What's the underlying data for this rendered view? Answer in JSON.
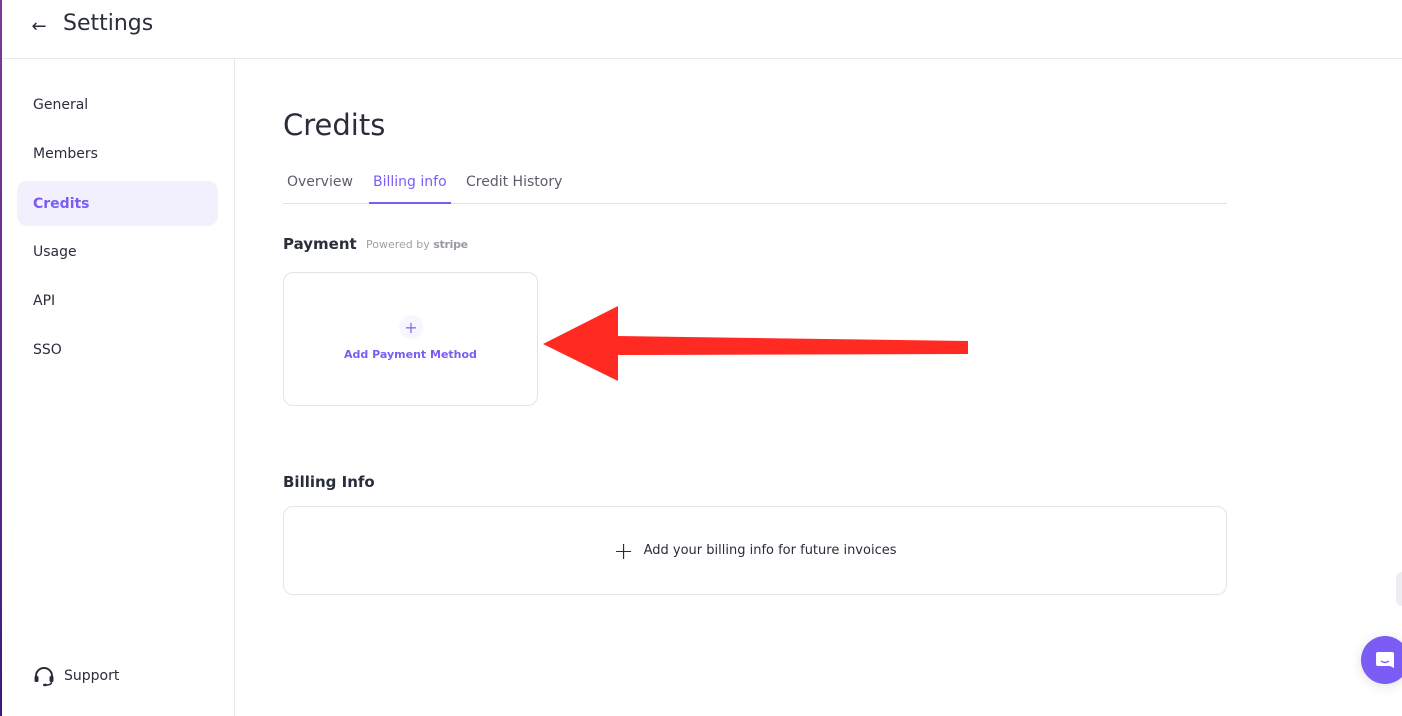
{
  "header": {
    "back_icon": "arrow-left-icon",
    "title": "Settings"
  },
  "sidebar": {
    "items": [
      {
        "label": "General",
        "active": false
      },
      {
        "label": "Members",
        "active": false
      },
      {
        "label": "Credits",
        "active": true
      },
      {
        "label": "Usage",
        "active": false
      },
      {
        "label": "API",
        "active": false
      },
      {
        "label": "SSO",
        "active": false
      }
    ],
    "support": {
      "label": "Support",
      "icon": "headset-icon"
    }
  },
  "main": {
    "title": "Credits",
    "tabs": [
      {
        "label": "Overview",
        "active": false
      },
      {
        "label": "Billing info",
        "active": true
      },
      {
        "label": "Credit History",
        "active": false
      }
    ],
    "payment": {
      "title": "Payment",
      "powered_by": "Powered by",
      "powered_brand": "stripe",
      "add_label": "Add Payment Method",
      "add_icon": "plus-icon"
    },
    "billing": {
      "title": "Billing Info",
      "add_label": "Add your billing info for future invoices",
      "add_icon": "plus-icon"
    }
  },
  "annotation": {
    "type": "arrow",
    "color": "#ff2a22",
    "points_to": "Add Payment Method"
  },
  "colors": {
    "accent": "#7b5cf5",
    "active_bg": "#f2f0fd",
    "text": "#2a2d3a"
  },
  "chat_widget": {
    "icon": "chat-icon"
  }
}
